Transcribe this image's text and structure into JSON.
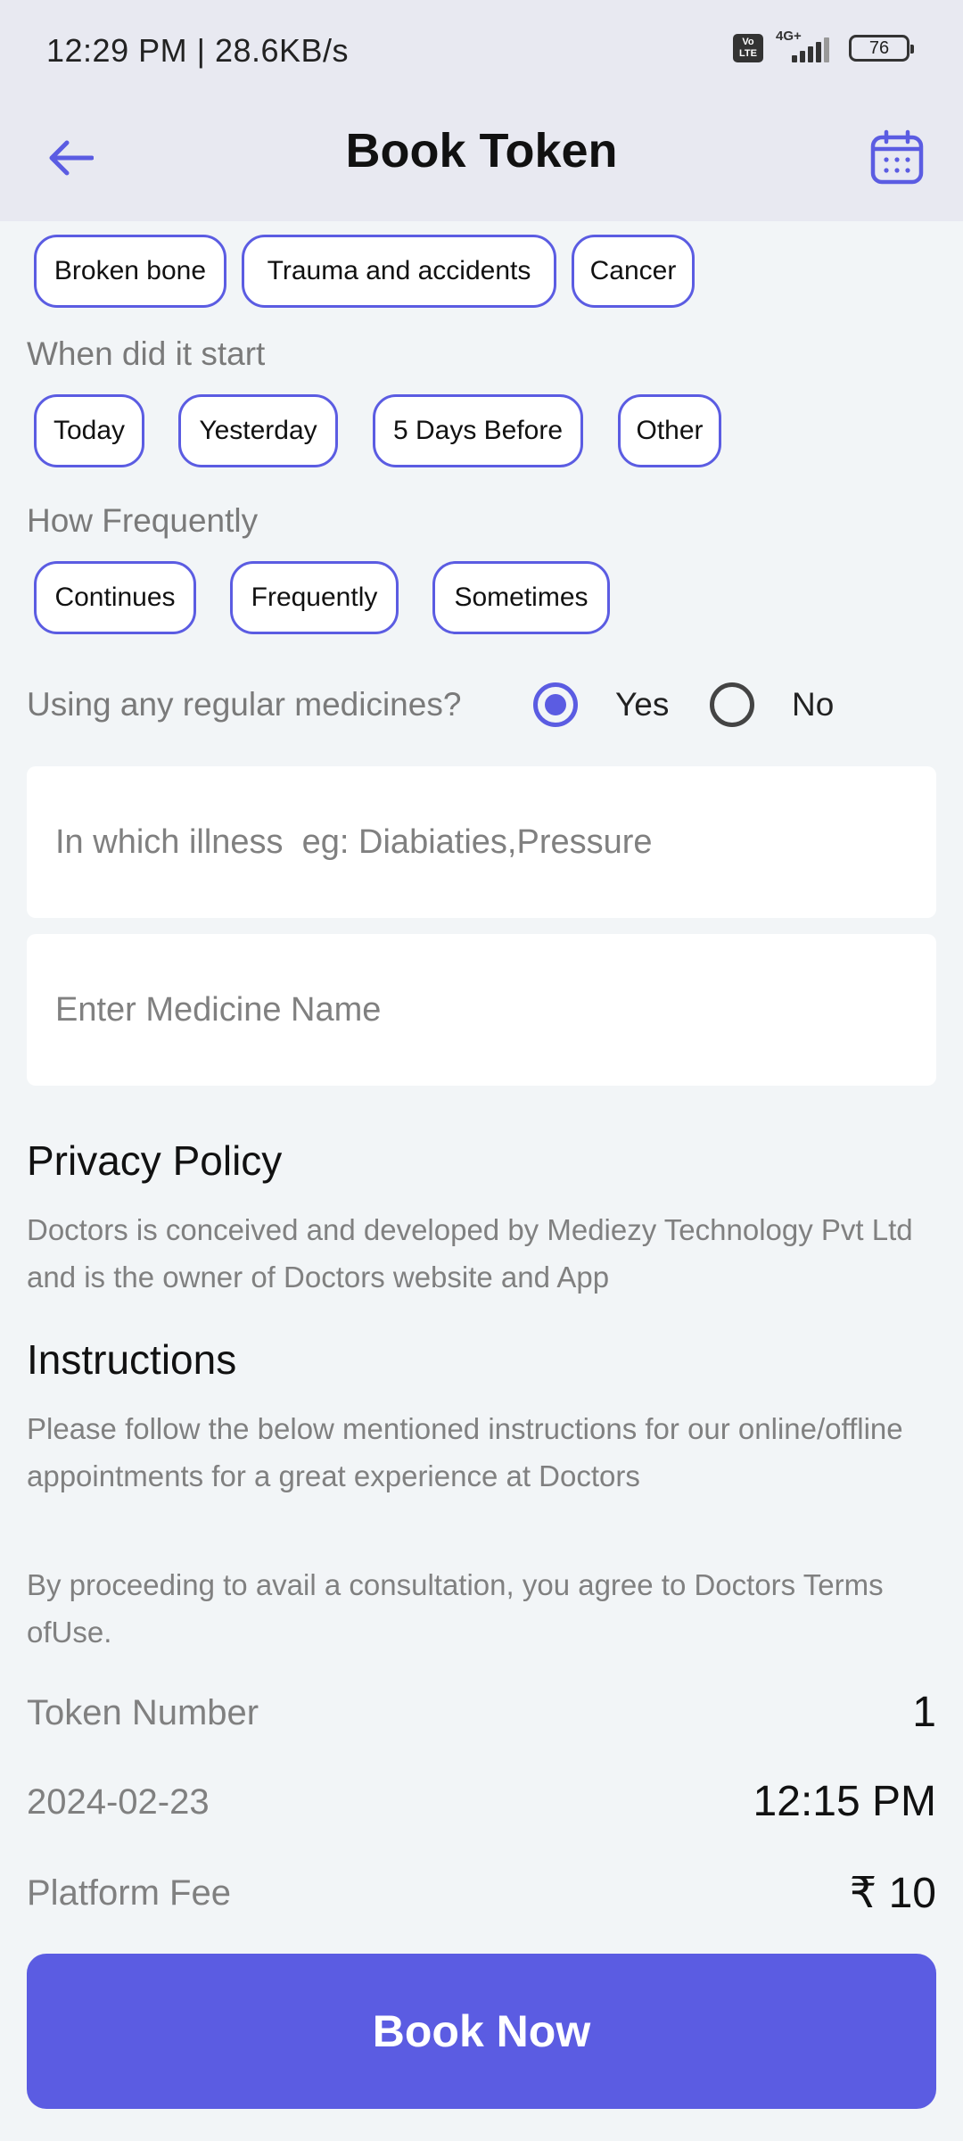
{
  "status_bar": {
    "time": "12:29 PM | 28.6KB/s",
    "volte": "Vo LTE",
    "network": "4G+",
    "battery": "76"
  },
  "header": {
    "title": "Book Token",
    "back_icon": "back-arrow-icon",
    "calendar_icon": "calendar-icon",
    "accent_color": "#5b5ce2"
  },
  "conditions": [
    "Broken bone",
    "Trauma and accidents",
    "Cancer"
  ],
  "when_started": {
    "label": "When did it start",
    "options": [
      "Today",
      "Yesterday",
      "5 Days Before",
      "Other"
    ]
  },
  "frequency": {
    "label": "How Frequently",
    "options": [
      "Continues",
      "Frequently",
      "Sometimes"
    ]
  },
  "regular_medicines": {
    "question": "Using any regular medicines?",
    "yes_label": "Yes",
    "no_label": "No",
    "selected": "Yes"
  },
  "illness_input": {
    "placeholder": "In which illness  eg: Diabiaties,Pressure",
    "value": ""
  },
  "medicine_input": {
    "placeholder": "Enter Medicine Name",
    "value": ""
  },
  "privacy": {
    "heading": "Privacy Policy",
    "text": "Doctors is conceived and developed by Mediezy Technology Pvt Ltd and is the owner of Doctors website and App"
  },
  "instructions": {
    "heading": "Instructions",
    "text1": "Please follow the below mentioned instructions for our online/offline appointments for a great experience at Doctors",
    "text2": "By proceeding to avail a consultation, you agree to Doctors Terms ofUse."
  },
  "token": {
    "number_label": "Token Number",
    "number_value": "1",
    "date": "2024-02-23",
    "time": "12:15 PM",
    "fee_label": "Platform Fee",
    "fee_value": "₹ 10"
  },
  "book_button": "Book Now"
}
